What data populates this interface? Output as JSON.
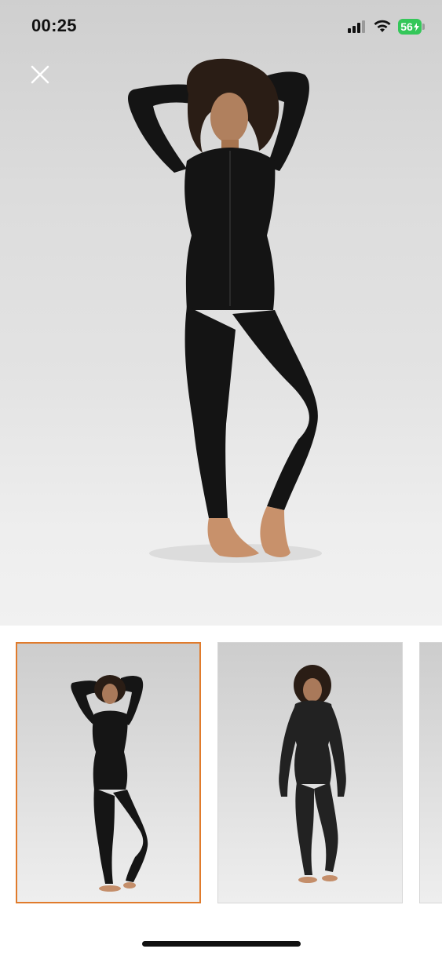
{
  "status_bar": {
    "time": "00:25",
    "battery_level": "56",
    "battery_charging": true,
    "battery_color": "#34c759"
  },
  "viewer": {
    "close_icon": "close-icon",
    "selected_thumbnail_border": "#e07b2c",
    "thumbnails": [
      {
        "selected": true
      },
      {
        "selected": false
      },
      {
        "selected": false
      }
    ]
  }
}
